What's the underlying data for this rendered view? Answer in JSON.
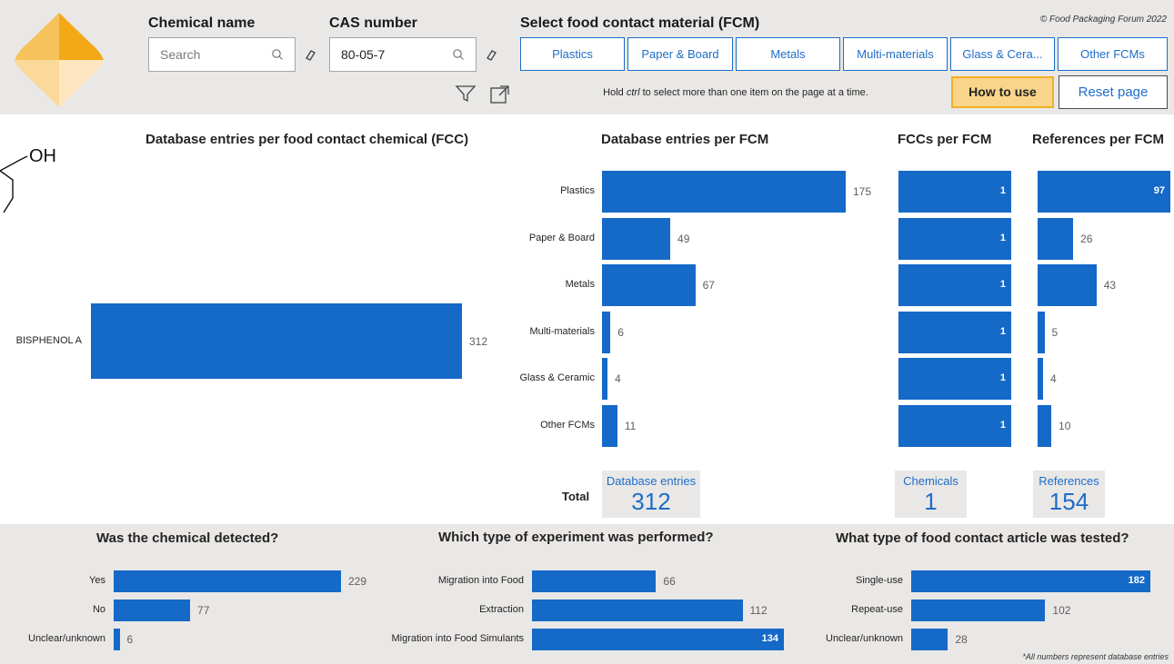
{
  "header": {
    "chem_name_label": "Chemical name",
    "chem_search_placeholder": "Search",
    "cas_label": "CAS number",
    "cas_value": "80-05-7",
    "fcm_label": "Select food contact material (FCM)",
    "copyright": "© Food Packaging Forum 2022",
    "fcm_buttons": [
      "Plastics",
      "Paper & Board",
      "Metals",
      "Multi-materials",
      "Glass & Cera...",
      "Other FCMs"
    ],
    "hint_pre": "Hold ",
    "hint_key": "ctrl",
    "hint_post": " to select more than one item on the page at a time.",
    "how_to_use": "How to use",
    "reset_page": "Reset page",
    "accent_color": "#f1b020",
    "bar_color": "#1569c7"
  },
  "structure_label": "OH",
  "fcc": {
    "title": "Database entries per food contact chemical (FCC)",
    "chart_data": {
      "type": "bar",
      "orientation": "horizontal",
      "categories": [
        "BISPHENOL A"
      ],
      "values": [
        312
      ],
      "title": "Database entries per food contact chemical (FCC)"
    }
  },
  "fcm": {
    "title": "Database entries per FCM",
    "chart_data": {
      "type": "bar",
      "orientation": "horizontal",
      "categories": [
        "Plastics",
        "Paper & Board",
        "Metals",
        "Multi-materials",
        "Glass & Ceramic",
        "Other FCMs"
      ],
      "values": [
        175,
        49,
        67,
        6,
        4,
        11
      ],
      "title": "Database entries per FCM"
    }
  },
  "fccs_per_fcm": {
    "title": "FCCs per FCM",
    "chart_data": {
      "type": "bar",
      "orientation": "horizontal",
      "categories": [
        "Plastics",
        "Paper & Board",
        "Metals",
        "Multi-materials",
        "Glass & Ceramic",
        "Other FCMs"
      ],
      "values": [
        1,
        1,
        1,
        1,
        1,
        1
      ],
      "title": "FCCs per FCM"
    }
  },
  "refs_per_fcm": {
    "title": "References per FCM",
    "chart_data": {
      "type": "bar",
      "orientation": "horizontal",
      "categories": [
        "Plastics",
        "Paper & Board",
        "Metals",
        "Multi-materials",
        "Glass & Ceramic",
        "Other FCMs"
      ],
      "values": [
        97,
        26,
        43,
        5,
        4,
        10
      ],
      "title": "References per FCM"
    }
  },
  "totals": {
    "label": "Total",
    "entries_title": "Database entries",
    "entries_value": "312",
    "chemicals_title": "Chemicals",
    "chemicals_value": "1",
    "references_title": "References",
    "references_value": "154"
  },
  "detected": {
    "title": "Was the chemical detected?",
    "chart_data": {
      "type": "bar",
      "orientation": "horizontal",
      "categories": [
        "Yes",
        "No",
        "Unclear/unknown"
      ],
      "values": [
        229,
        77,
        6
      ],
      "title": "Was the chemical detected?"
    }
  },
  "experiment": {
    "title": "Which type of experiment was performed?",
    "chart_data": {
      "type": "bar",
      "orientation": "horizontal",
      "categories": [
        "Migration into Food",
        "Extraction",
        "Migration into Food Simulants"
      ],
      "values": [
        66,
        112,
        134
      ],
      "title": "Which type of experiment was performed?"
    }
  },
  "article": {
    "title": "What type of food contact article was tested?",
    "chart_data": {
      "type": "bar",
      "orientation": "horizontal",
      "categories": [
        "Single-use",
        "Repeat-use",
        "Unclear/unknown"
      ],
      "values": [
        182,
        102,
        28
      ],
      "title": "What type of food contact article was tested?"
    }
  },
  "footnote": "*All numbers represent database entries"
}
